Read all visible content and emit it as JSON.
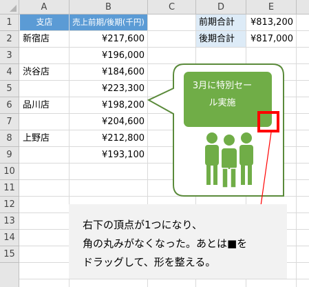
{
  "columns": [
    "A",
    "B",
    "C",
    "D",
    "E"
  ],
  "rows": [
    "1",
    "2",
    "3",
    "4",
    "5",
    "6",
    "7",
    "8",
    "9",
    "10",
    "11",
    "12",
    "13",
    "14",
    "15"
  ],
  "table": {
    "header_branch": "支店",
    "header_sales": "売上前期/後期(千円)",
    "branches": [
      "新宿店",
      "",
      "渋谷店",
      "",
      "品川店",
      "",
      "上野店",
      ""
    ],
    "sales": [
      "¥217,600",
      "¥196,000",
      "¥184,600",
      "¥223,300",
      "¥198,200",
      "¥204,600",
      "¥212,800",
      "¥193,100"
    ]
  },
  "summary": {
    "first_label": "前期合計",
    "first_value": "¥813,200",
    "second_label": "後期合計",
    "second_value": "¥817,000"
  },
  "callout": {
    "line1": "3月に特別セー",
    "line2": "ル実施",
    "icon": "people-group-icon",
    "fill_color": "#70ad47",
    "border_color": "#5a8a3a"
  },
  "note": {
    "line1": "右下の頂点が1つになり、",
    "line2": "角の丸みがなくなった。あとは■を",
    "line3": "ドラッグして、形を整える。"
  },
  "colors": {
    "header_fill": "#5b9bd5",
    "light_fill": "#ddebf7",
    "highlight": "#ff0000"
  }
}
